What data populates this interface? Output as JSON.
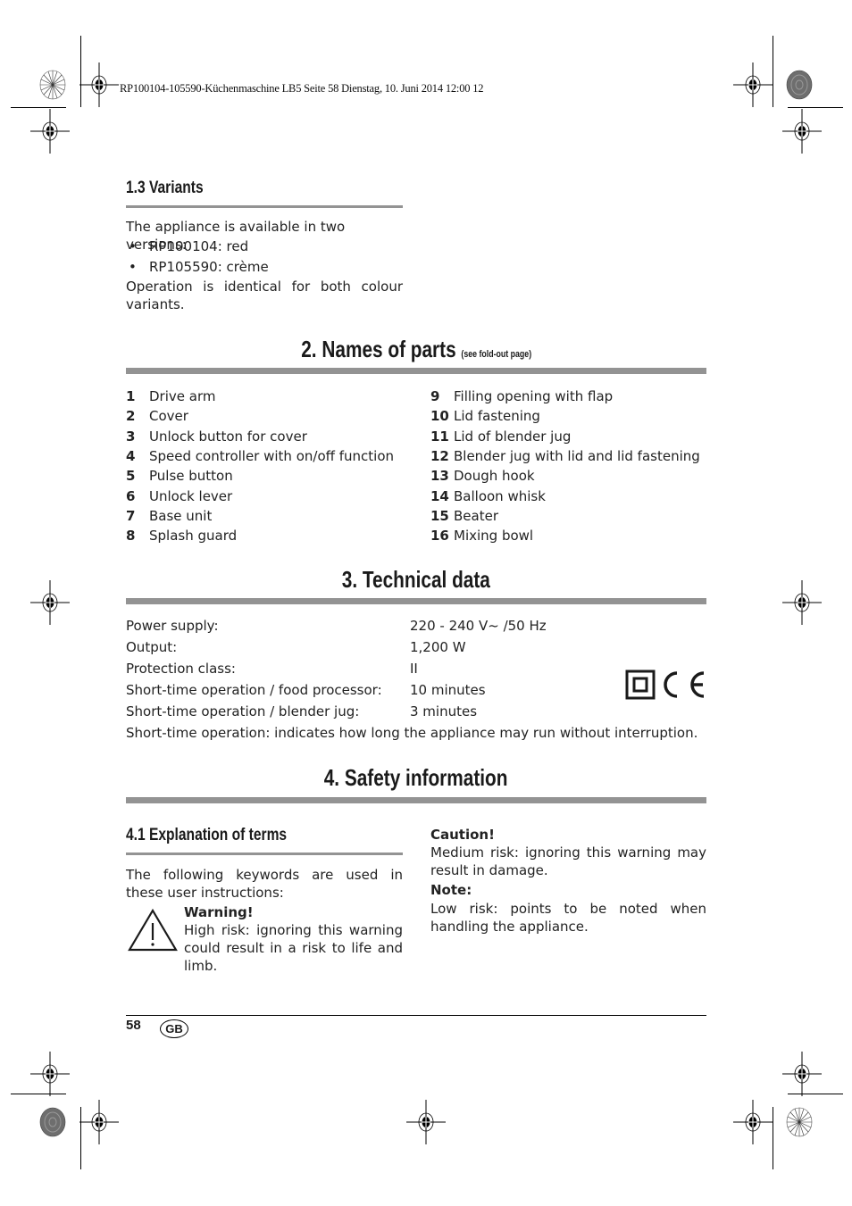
{
  "slug": "RP100104-105590-Küchenmaschine LB5  Seite 58  Dienstag, 10. Juni 2014  12:00 12",
  "variants": {
    "heading": "1.3 Variants",
    "intro": "The appliance is available in two versions:",
    "items": [
      "RP100104: red",
      "RP105590: crème"
    ],
    "note": "Operation is identical for both colour variants.",
    "bullet": "•"
  },
  "parts": {
    "heading": "2. Names of parts",
    "heading_note": "(see fold-out page)",
    "left": [
      {
        "num": "1",
        "label": "Drive arm"
      },
      {
        "num": "2",
        "label": "Cover"
      },
      {
        "num": "3",
        "label": "Unlock button for cover"
      },
      {
        "num": "4",
        "label": "Speed controller with on/off function"
      },
      {
        "num": "5",
        "label": "Pulse button"
      },
      {
        "num": "6",
        "label": "Unlock lever"
      },
      {
        "num": "7",
        "label": "Base unit"
      },
      {
        "num": "8",
        "label": "Splash guard"
      }
    ],
    "right": [
      {
        "num": "9",
        "label": "Filling opening with flap"
      },
      {
        "num": "10",
        "label": "Lid fastening"
      },
      {
        "num": "11",
        "label": "Lid of blender jug"
      },
      {
        "num": "12",
        "label": "Blender jug with lid and lid fastening"
      },
      {
        "num": "13",
        "label": "Dough hook"
      },
      {
        "num": "14",
        "label": "Balloon whisk"
      },
      {
        "num": "15",
        "label": "Beater"
      },
      {
        "num": "16",
        "label": "Mixing bowl"
      }
    ]
  },
  "technical": {
    "heading": "3. Technical data",
    "rows": [
      {
        "label": "Power supply:",
        "value": "220 - 240 V~ /50 Hz"
      },
      {
        "label": "Output:",
        "value": "1,200 W"
      },
      {
        "label": "Protection class:",
        "value": "II"
      },
      {
        "label": "Short-time operation / food processor:",
        "value": "10 minutes"
      },
      {
        "label": "Short-time operation / blender jug:",
        "value": "3 minutes"
      }
    ],
    "footnote": "Short-time operation: indicates how long the appliance may run without interruption.",
    "marks": [
      "protection-class-ii",
      "ce-mark"
    ]
  },
  "safety": {
    "heading": "4. Safety information",
    "sub_heading": "4.1 Explanation of terms",
    "intro": "The following keywords are used in these user instructions:",
    "warning": {
      "title": "Warning!",
      "text": "High risk: ignoring this warning could result in a risk to life and limb."
    },
    "caution": {
      "title": "Caution!",
      "text": "Medium risk: ignoring this warning may result in damage."
    },
    "note": {
      "title": "Note:",
      "text": "Low risk: points to be noted when handling the appliance."
    }
  },
  "footer": {
    "page_number": "58",
    "language": "GB"
  }
}
